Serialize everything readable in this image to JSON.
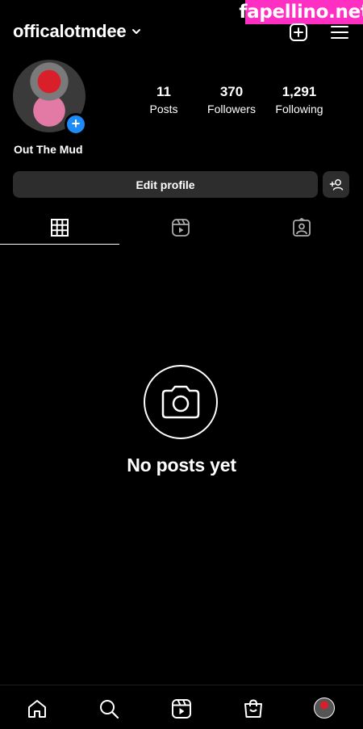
{
  "watermark": {
    "text": "fapellino.net"
  },
  "header": {
    "username": "officalotmdee",
    "icons": [
      "chevron-down-icon",
      "add-post-icon",
      "menu-icon"
    ]
  },
  "profile": {
    "display_name": "Out The Mud",
    "stats": [
      {
        "value": "11",
        "label": "Posts"
      },
      {
        "value": "370",
        "label": "Followers"
      },
      {
        "value": "1,291",
        "label": "Following"
      }
    ],
    "add_story_badge": "+"
  },
  "actions": {
    "edit_profile": "Edit profile",
    "discover_people_icon": "add-person-icon"
  },
  "tabs": [
    {
      "name": "grid",
      "icon": "grid-icon",
      "active": true
    },
    {
      "name": "reels",
      "icon": "reels-icon",
      "active": false
    },
    {
      "name": "tagged",
      "icon": "tagged-icon",
      "active": false
    }
  ],
  "empty_state": {
    "message": "No posts yet",
    "icon": "camera-icon"
  },
  "bottom_nav": [
    "home-icon",
    "search-icon",
    "reels-icon",
    "shop-icon",
    "profile-avatar"
  ],
  "colors": {
    "background": "#000000",
    "button": "#2d2d2d",
    "badge": "#1d8cf8",
    "watermark": "#ff2fc3"
  }
}
